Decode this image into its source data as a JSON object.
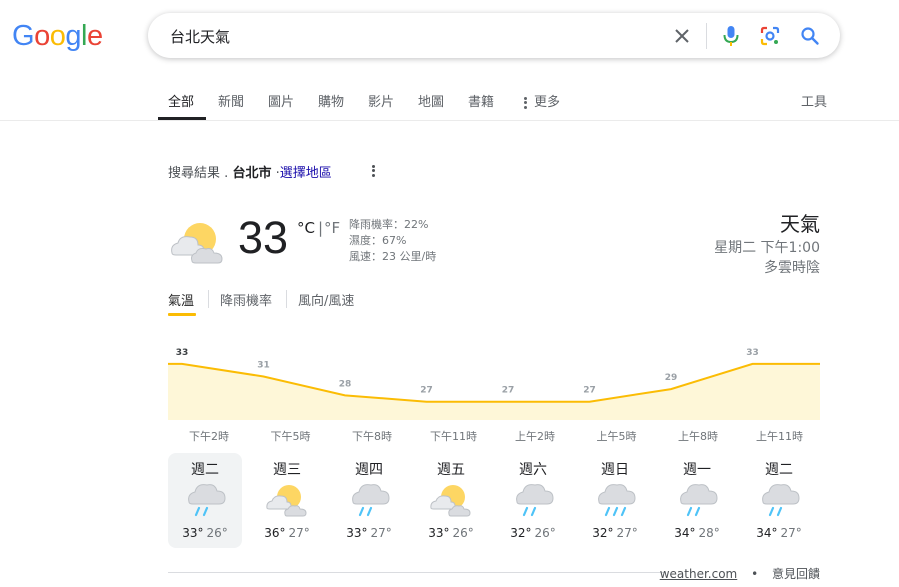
{
  "logo": {
    "letters": [
      "G",
      "o",
      "o",
      "g",
      "l",
      "e"
    ],
    "colors": [
      "#4285f4",
      "#ea4335",
      "#fbbc05",
      "#4285f4",
      "#34a853",
      "#ea4335"
    ]
  },
  "search": {
    "query": "台北天氣",
    "icons": [
      "clear-icon",
      "microphone-icon",
      "lens-icon",
      "search-icon"
    ]
  },
  "tabs": [
    {
      "label": "全部"
    },
    {
      "label": "新聞"
    },
    {
      "label": "圖片"
    },
    {
      "label": "購物"
    },
    {
      "label": "影片"
    },
    {
      "label": "地圖"
    },
    {
      "label": "書籍"
    },
    {
      "label": "更多"
    }
  ],
  "tools_label": "工具",
  "location": {
    "prefix": "搜尋結果",
    "dot": ".",
    "city": "台北市",
    "sep": "·",
    "change": "選擇地區"
  },
  "current": {
    "temp": "33",
    "unit_c": "°C",
    "unit_sep": "|",
    "unit_f": "°F",
    "precip": "降雨機率：22%",
    "humidity": "濕度：67%",
    "wind": "風速：23 公里/時",
    "icon": "partly-cloudy-icon"
  },
  "summary": {
    "title": "天氣",
    "time": "星期二 下午1:00",
    "condition": "多雲時陰"
  },
  "subtabs": [
    {
      "label": "氣溫"
    },
    {
      "label": "降雨機率"
    },
    {
      "label": "風向/風速"
    }
  ],
  "colors": {
    "accent": "#fbbc04",
    "fill": "#fef7d8",
    "link": "#1a0dab",
    "rain": "#4fc3f7"
  },
  "chart_data": {
    "type": "area",
    "x": [
      "下午2時",
      "下午5時",
      "下午8時",
      "下午11時",
      "上午2時",
      "上午5時",
      "上午8時",
      "上午11時"
    ],
    "values": [
      33,
      31,
      28,
      27,
      27,
      27,
      29,
      33
    ],
    "labels": [
      "33",
      "31",
      "28",
      "27",
      "27",
      "27",
      "29",
      "33"
    ]
  },
  "forecast": [
    {
      "day": "週二",
      "hi": "33°",
      "lo": "26°",
      "icon": "rain-icon"
    },
    {
      "day": "週三",
      "hi": "36°",
      "lo": "27°",
      "icon": "partly-cloudy-icon"
    },
    {
      "day": "週四",
      "hi": "33°",
      "lo": "27°",
      "icon": "rain-icon"
    },
    {
      "day": "週五",
      "hi": "33°",
      "lo": "26°",
      "icon": "partly-cloudy-icon"
    },
    {
      "day": "週六",
      "hi": "32°",
      "lo": "26°",
      "icon": "rain-icon"
    },
    {
      "day": "週日",
      "hi": "32°",
      "lo": "27°",
      "icon": "rain-icon"
    },
    {
      "day": "週一",
      "hi": "34°",
      "lo": "28°",
      "icon": "rain-icon"
    },
    {
      "day": "週二",
      "hi": "34°",
      "lo": "27°",
      "icon": "rain-icon"
    }
  ],
  "footer": {
    "source": "weather.com",
    "dot": "•",
    "feedback": "意見回饋"
  }
}
